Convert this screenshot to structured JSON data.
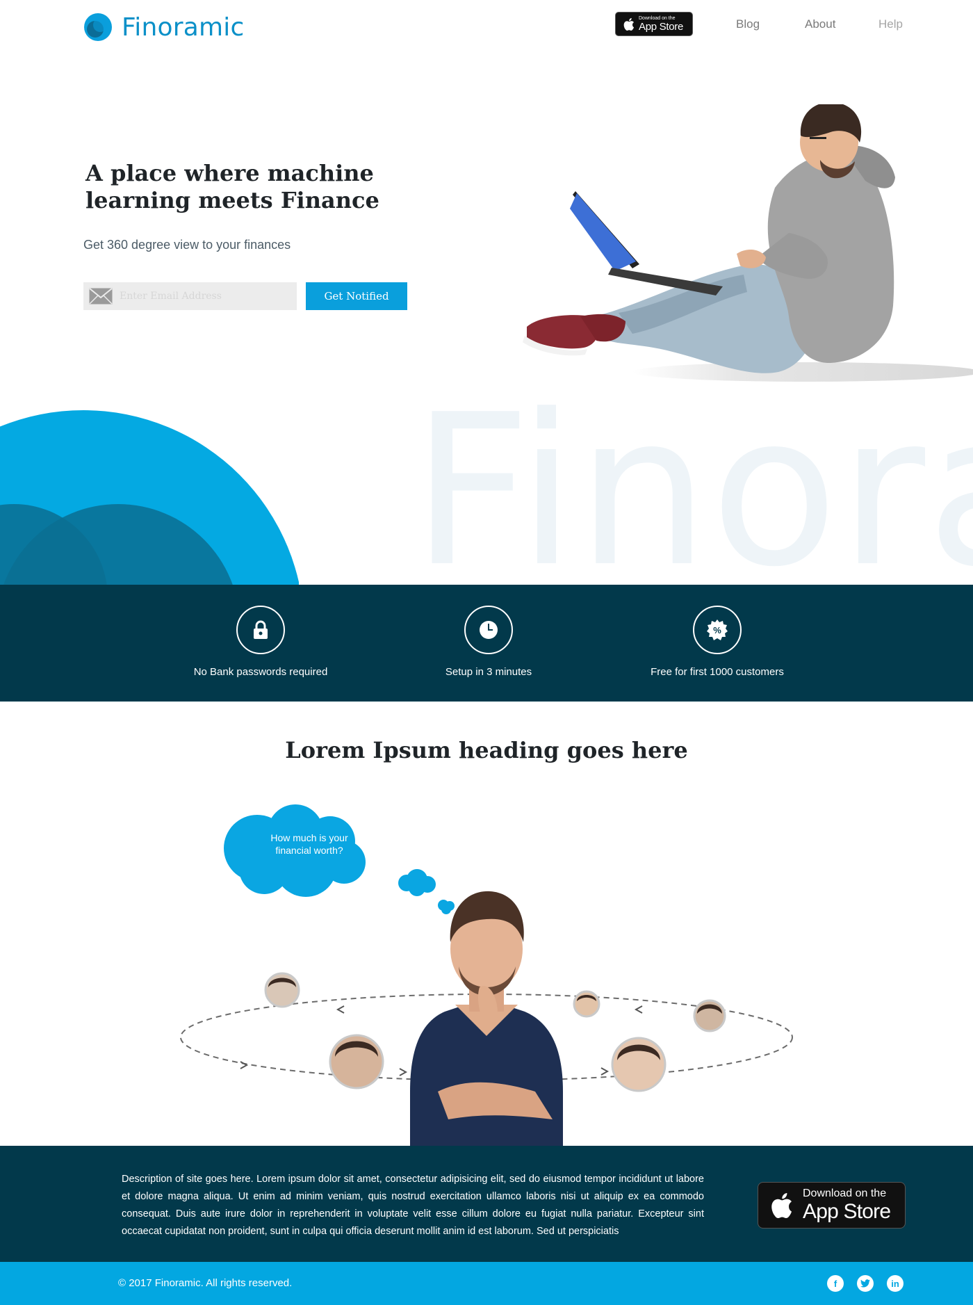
{
  "header": {
    "logo_text": "Finoramic",
    "appstore_small": {
      "line1": "Download on the",
      "line2": "App Store"
    },
    "nav": {
      "blog": "Blog",
      "about": "About",
      "help": "Help"
    }
  },
  "hero": {
    "title": "A place where machine learning meets Finance",
    "subtitle": "Get 360 degree view to your finances",
    "email_placeholder": "Enter Email Address",
    "email_value": "",
    "cta_label": "Get Notified"
  },
  "band": {
    "watermark": "Finoramic"
  },
  "features": [
    {
      "icon": "lock-icon",
      "label": "No Bank passwords required"
    },
    {
      "icon": "clock-icon",
      "label": "Setup in 3 minutes"
    },
    {
      "icon": "percent-badge-icon",
      "label": "Free for first 1000 customers"
    }
  ],
  "section": {
    "title": "Lorem Ipsum heading goes here",
    "thought": "How much is your financial worth?"
  },
  "footer": {
    "description": "Description of site goes here. Lorem ipsum dolor sit amet, consectetur adipisicing elit, sed do eiusmod tempor incididunt ut labore et dolore magna aliqua. Ut enim ad minim veniam, quis nostrud exercitation ullamco laboris nisi ut aliquip ex ea commodo consequat. Duis aute irure dolor in reprehenderit in voluptate velit esse cillum dolore eu fugiat nulla pariatur. Excepteur sint occaecat cupidatat non proident, sunt in culpa qui officia deserunt mollit anim id est laborum. Sed ut perspiciatis",
    "appstore_big": {
      "line1": "Download on the",
      "line2": "App Store"
    },
    "copyright": "© 2017 Finoramic. All rights reserved.",
    "social": {
      "facebook": "f",
      "twitter": "t",
      "linkedin": "in"
    }
  },
  "colors": {
    "brand_blue": "#0a9fdc",
    "dark_navy": "#02394b",
    "bottom_bar": "#03a7e1",
    "logo_blue": "#0b90c8"
  }
}
